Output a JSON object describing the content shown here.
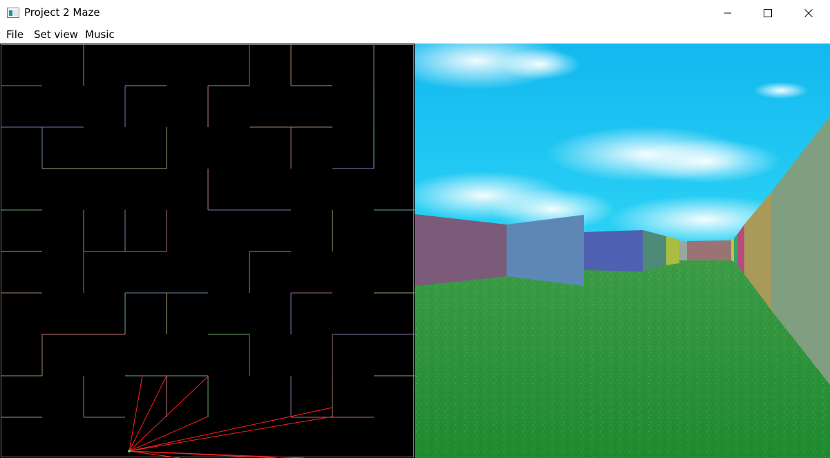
{
  "window": {
    "title": "Project 2 Maze",
    "icon": "app-window-icon",
    "controls": [
      "minimize-icon",
      "maximize-icon",
      "close-icon"
    ]
  },
  "menu": {
    "items": [
      {
        "label": "File"
      },
      {
        "label": "Set view"
      },
      {
        "label": "Music"
      }
    ]
  },
  "map": {
    "background": "#000000",
    "ray_color": "#ff2020"
  },
  "view": {
    "sky_color": "#1fc6f2",
    "floor_color": "#2a9a3a"
  }
}
